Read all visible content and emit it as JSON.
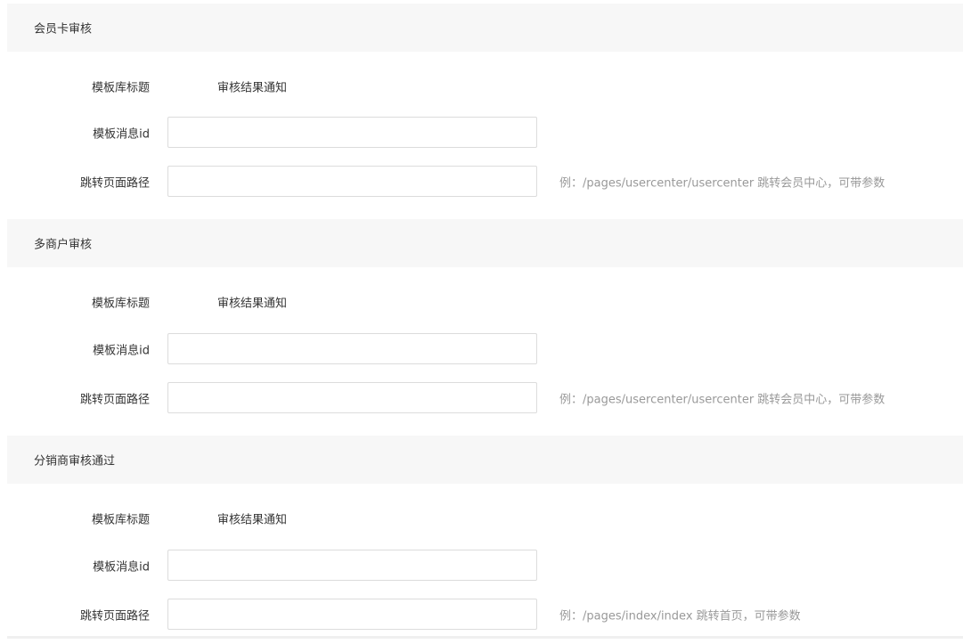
{
  "sections": [
    {
      "title": "会员卡审核",
      "template_library_title_label": "模板库标题",
      "template_library_title_value": "审核结果通知",
      "template_message_id_label": "模板消息id",
      "template_message_id_value": "",
      "jump_path_label": "跳转页面路径",
      "jump_path_value": "",
      "jump_path_hint": "例：/pages/usercenter/usercenter 跳转会员中心，可带参数"
    },
    {
      "title": "多商户审核",
      "template_library_title_label": "模板库标题",
      "template_library_title_value": "审核结果通知",
      "template_message_id_label": "模板消息id",
      "template_message_id_value": "",
      "jump_path_label": "跳转页面路径",
      "jump_path_value": "",
      "jump_path_hint": "例：/pages/usercenter/usercenter 跳转会员中心，可带参数"
    },
    {
      "title": "分销商审核通过",
      "template_library_title_label": "模板库标题",
      "template_library_title_value": "审核结果通知",
      "template_message_id_label": "模板消息id",
      "template_message_id_value": "",
      "jump_path_label": "跳转页面路径",
      "jump_path_value": "",
      "jump_path_hint": "例：/pages/index/index 跳转首页，可带参数"
    }
  ]
}
